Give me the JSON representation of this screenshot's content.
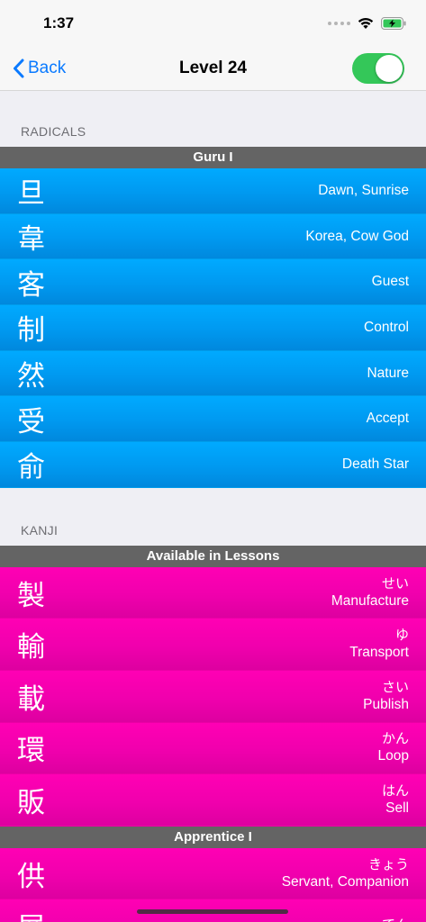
{
  "status": {
    "time": "1:37"
  },
  "nav": {
    "back_label": "Back",
    "title": "Level 24",
    "toggle_on": true
  },
  "radicals": {
    "section_label": "RADICALS",
    "group": "Guru I",
    "items": [
      {
        "char": "旦",
        "meaning": "Dawn, Sunrise"
      },
      {
        "char": "韋",
        "meaning": "Korea, Cow God"
      },
      {
        "char": "客",
        "meaning": "Guest"
      },
      {
        "char": "制",
        "meaning": "Control"
      },
      {
        "char": "然",
        "meaning": "Nature"
      },
      {
        "char": "受",
        "meaning": "Accept"
      },
      {
        "char": "俞",
        "meaning": "Death Star"
      }
    ]
  },
  "kanji": {
    "section_label": "KANJI",
    "groups": [
      {
        "name": "Available in Lessons",
        "items": [
          {
            "char": "製",
            "reading": "せい",
            "meaning": "Manufacture"
          },
          {
            "char": "輸",
            "reading": "ゆ",
            "meaning": "Transport"
          },
          {
            "char": "載",
            "reading": "さい",
            "meaning": "Publish"
          },
          {
            "char": "環",
            "reading": "かん",
            "meaning": "Loop"
          },
          {
            "char": "販",
            "reading": "はん",
            "meaning": "Sell"
          }
        ]
      },
      {
        "name": "Apprentice I",
        "items": [
          {
            "char": "供",
            "reading": "きょう",
            "meaning": "Servant, Companion"
          },
          {
            "char": "展",
            "reading": "てん",
            "meaning": ""
          }
        ]
      }
    ]
  },
  "colors": {
    "radical": "#00aaff",
    "kanji": "#ff00b4",
    "group_header": "#646464",
    "accent": "#0a7aff",
    "toggle": "#34c759"
  }
}
